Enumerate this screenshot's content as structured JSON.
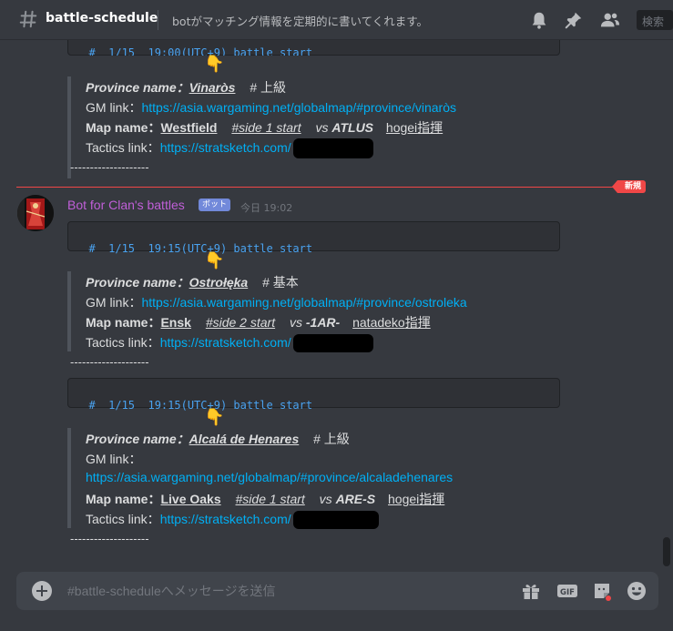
{
  "header": {
    "channel_name": "battle-schedule",
    "topic": "botがマッチング情報を定期的に書いてくれます。",
    "search_placeholder": "検索"
  },
  "partial_block": {
    "code_line": "#  1/15  19:00(UTC+9) battle start",
    "province_label": "Province name：",
    "province_value": "Vinaròs",
    "province_tag": "# 上級",
    "gm_label": "GM link：",
    "gm_url": "https://asia.wargaming.net/globalmap/#province/vinaròs",
    "map_label": "Map name：",
    "map_value": "Westfield",
    "side": "#side 1 start",
    "vs_label": "vs",
    "opponent": "ATLUS",
    "commander_name": "hogei",
    "commander_suffix": "指揮",
    "tactics_label": "Tactics link：",
    "tactics_url": "https://stratsketch.com/",
    "separator": "--------------------"
  },
  "divider": {
    "label": "新規"
  },
  "message": {
    "author": "Bot for Clan's battles",
    "badge": "ボット",
    "timestamp": "今日 19:02",
    "battles": [
      {
        "code_line": "#  1/15  19:15(UTC+9) battle start",
        "province_label": "Province name：",
        "province_value": "Ostrołęka",
        "province_tag": "# 基本",
        "gm_label": "GM link：",
        "gm_url": "https://asia.wargaming.net/globalmap/#province/ostroleka",
        "map_label": "Map name：",
        "map_value": "Ensk",
        "side": "#side 2 start",
        "vs_label": "vs",
        "opponent": "-1AR-",
        "commander_name": "natadeko",
        "commander_suffix": "指揮",
        "tactics_label": "Tactics link：",
        "tactics_url": "https://stratsketch.com/",
        "separator": "--------------------"
      },
      {
        "code_line": "#  1/15  19:15(UTC+9) battle start",
        "province_label": "Province name：",
        "province_value": "Alcalá de Henares",
        "province_tag": "# 上級",
        "gm_label": "GM link：",
        "gm_url": "https://asia.wargaming.net/globalmap/#province/alcaladehenares",
        "map_label": "Map name：",
        "map_value": "Live Oaks",
        "side": "#side 1 start",
        "vs_label": "vs",
        "opponent": "ARE-S",
        "commander_name": "hogei",
        "commander_suffix": "指揮",
        "tactics_label": "Tactics link：",
        "tactics_url": "https://stratsketch.com/",
        "separator": "--------------------"
      }
    ]
  },
  "composer": {
    "placeholder": "#battle-scheduleへメッセージを送信"
  },
  "colors": {
    "background": "#36393f",
    "link": "#00aff4",
    "author": "#c05fd8",
    "new_marker": "#f04747",
    "bot_badge": "#7289da"
  }
}
